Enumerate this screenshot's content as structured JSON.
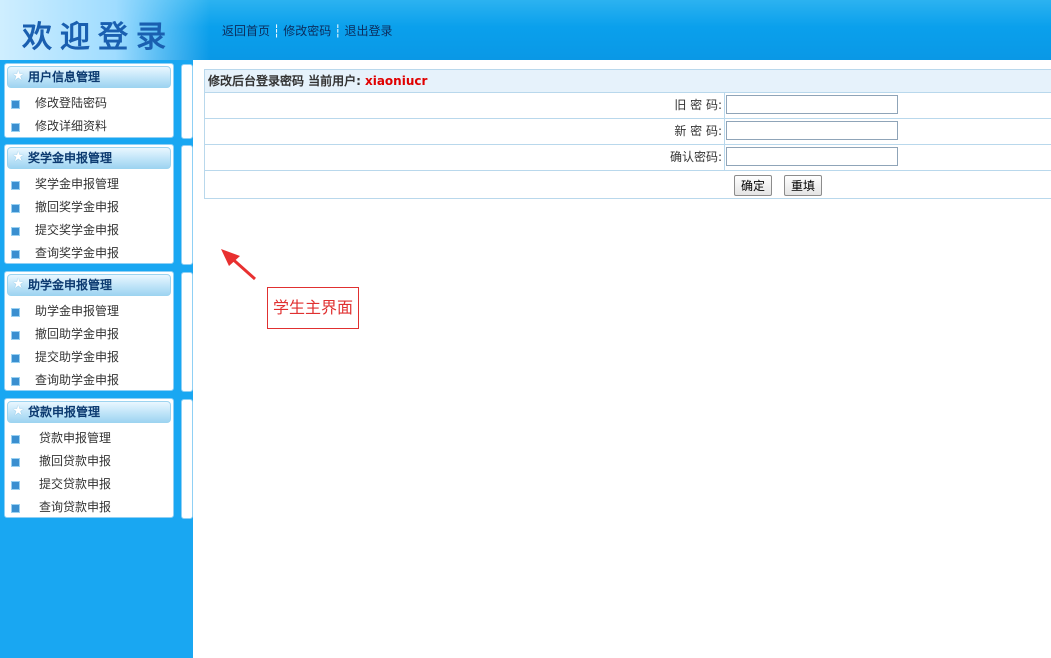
{
  "header": {
    "title": "欢迎登录",
    "links": [
      "返回首页",
      "修改密码",
      "退出登录"
    ],
    "separator": "┆"
  },
  "sidebar": {
    "sections": [
      {
        "title": "用户信息管理",
        "items": [
          "修改登陆密码",
          "修改详细资料"
        ]
      },
      {
        "title": "奖学金申报管理",
        "items": [
          "奖学金申报管理",
          "撤回奖学金申报",
          "提交奖学金申报",
          "查询奖学金申报"
        ]
      },
      {
        "title": "助学金申报管理",
        "items": [
          "助学金申报管理",
          "撤回助学金申报",
          "提交助学金申报",
          "查询助学金申报"
        ]
      },
      {
        "title": "贷款申报管理",
        "items": [
          "贷款申报管理",
          "撤回贷款申报",
          "提交贷款申报",
          "查询贷款申报"
        ]
      }
    ]
  },
  "form": {
    "heading": "修改后台登录密码 当前用户:",
    "username": "xiaoniucr",
    "fields": [
      {
        "label": "旧 密 码:",
        "value": ""
      },
      {
        "label": "新 密 码:",
        "value": ""
      },
      {
        "label": "确认密码:",
        "value": ""
      }
    ],
    "submit_label": "确定",
    "reset_label": "重填"
  },
  "annotation": {
    "text": "学生主界面"
  },
  "colors": {
    "header_blue": "#0aa0ec",
    "sidebar_blue": "#19a7f2",
    "title_text": "#1a5fb0",
    "username_red": "#e00000",
    "annotation_red": "#e03030"
  }
}
